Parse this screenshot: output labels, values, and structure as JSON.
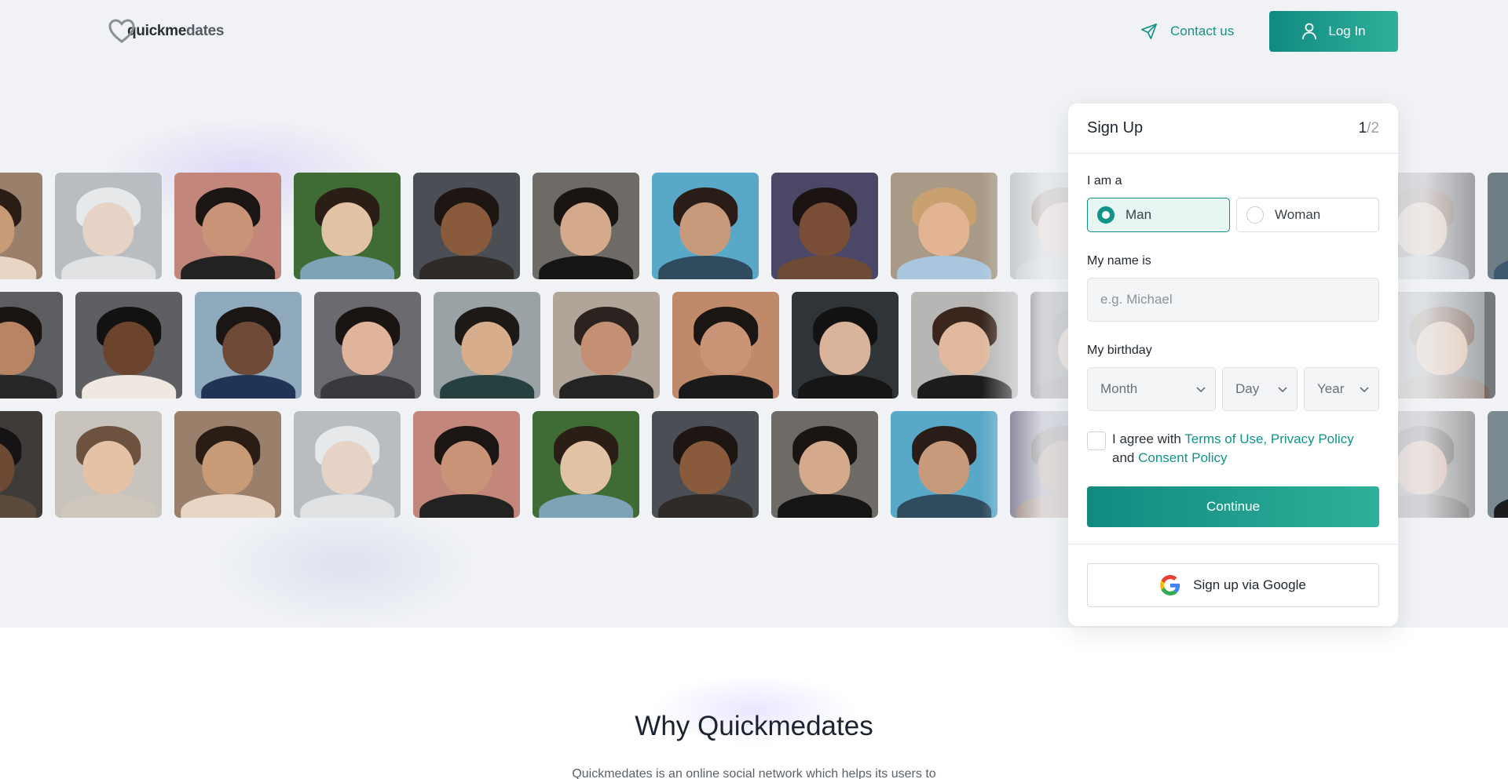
{
  "header": {
    "logo_bold": "quickme",
    "logo_light": "dates",
    "contact_label": "Contact us",
    "login_label": "Log In"
  },
  "signup": {
    "title": "Sign Up",
    "step_current": "1",
    "step_total": "/2",
    "iam_label": "I am a",
    "gender_options": [
      "Man",
      "Woman"
    ],
    "gender_selected": "Man",
    "name_label": "My name is",
    "name_placeholder": "e.g. Michael",
    "birthday_label": "My birthday",
    "month_placeholder": "Month",
    "day_placeholder": "Day",
    "year_placeholder": "Year",
    "agree_prefix": "I agree with ",
    "terms_link": "Terms of Use,",
    "privacy_link": "Privacy Policy",
    "agree_and": " and ",
    "consent_link": "Consent Policy",
    "continue_label": "Continue",
    "google_label": "Sign up via Google"
  },
  "why": {
    "title": "Why Quickmedates",
    "text": "Quickmedates is an online social network which helps its users to"
  },
  "colors": {
    "accent": "#129389",
    "accent_light": "#2fb09a",
    "hero_bg": "#f0f2f5"
  },
  "photos": [
    {
      "bg": "#9a7f6a",
      "face": "#c79a78",
      "hair": "#2a1d16",
      "body": "#e8d5c4"
    },
    {
      "bg": "#b9bdc2",
      "face": "#e7d3c6",
      "hair": "#e6e8ea",
      "body": "#dfe1e3"
    },
    {
      "bg": "#c2867a",
      "face": "#c99378",
      "hair": "#1b1613",
      "body": "#222222"
    },
    {
      "bg": "#3f6b35",
      "face": "#e2c2a5",
      "hair": "#2a1e17",
      "body": "#7ea3b6"
    },
    {
      "bg": "#4b4f55",
      "face": "#8a5a3c",
      "hair": "#1e1612",
      "body": "#2f2b29"
    },
    {
      "bg": "#6e6a66",
      "face": "#d4a98c",
      "hair": "#1a1412",
      "body": "#151515"
    },
    {
      "bg": "#5aa8c8",
      "face": "#c89a7c",
      "hair": "#2a1d17",
      "body": "#2f4c5e"
    },
    {
      "bg": "#4b4766",
      "face": "#7a4e36",
      "hair": "#1b1412",
      "body": "#6f4a37"
    },
    {
      "bg": "#a89a86",
      "face": "#e2b494",
      "hair": "#c9a170",
      "body": "#a9c6de"
    },
    {
      "bg": "#aab2b3",
      "face": "#d9b99f",
      "hair": "#6d5140",
      "body": "#b7c1c3"
    },
    {
      "bg": "#5d5a58",
      "face": "#c48a6a",
      "hair": "#1a1513",
      "body": "#2f2c2a"
    },
    {
      "bg": "#7b8a92",
      "face": "#e1bda4",
      "hair": "#b58a64",
      "body": "#1d1d1f"
    },
    {
      "bg": "#56575a",
      "face": "#d7b399",
      "hair": "#5a3d2b",
      "body": "#9aa3ad"
    },
    {
      "bg": "#6f7d86",
      "face": "#b78b6d",
      "hair": "#2a1f1a",
      "body": "#3e5870"
    },
    {
      "bg": "#5b5d60",
      "face": "#b88463",
      "hair": "#1a1412",
      "body": "#262626"
    },
    {
      "bg": "#5e5f63",
      "face": "#6c432d",
      "hair": "#141111",
      "body": "#efe8e1"
    },
    {
      "bg": "#8fa9bd",
      "face": "#6e4a37",
      "hair": "#1b1513",
      "body": "#1f3558"
    },
    {
      "bg": "#6a6a70",
      "face": "#e0b49a",
      "hair": "#1a1512",
      "body": "#3a3a3e"
    },
    {
      "bg": "#9aa2a6",
      "face": "#d7ad8c",
      "hair": "#1d1917",
      "body": "#264040"
    },
    {
      "bg": "#b1a59a",
      "face": "#c48f73",
      "hair": "#2c2220",
      "body": "#242424"
    },
    {
      "bg": "#c08a6a",
      "face": "#c99376",
      "hair": "#1b1513",
      "body": "#1a1a1a"
    },
    {
      "bg": "#2f3438",
      "face": "#d9b39a",
      "hair": "#121212",
      "body": "#161616"
    },
    {
      "bg": "#b7b6b5",
      "face": "#e0b89d",
      "hair": "#3a261c",
      "body": "#1c1c1c"
    },
    {
      "bg": "#2c2c2c",
      "face": "#c59a7c",
      "hair": "#151515",
      "body": "#141414"
    },
    {
      "bg": "#7a3b24",
      "face": "#8b5a3c",
      "hair": "#1a1310",
      "body": "#efe2d6"
    },
    {
      "bg": "#1b1b1b",
      "face": "#d8b090",
      "hair": "#2b1f19",
      "body": "#8b5a3b"
    },
    {
      "bg": "#75797c",
      "face": "#dcb293",
      "hair": "#5b3d2b",
      "body": "#7b6a5f"
    },
    {
      "bg": "#3f3b39",
      "face": "#6e4a35",
      "hair": "#151313",
      "body": "#5b4a3a"
    },
    {
      "bg": "#c8c3bc",
      "face": "#e5c1a5",
      "hair": "#6d5240",
      "body": "#cfc7bd"
    }
  ]
}
